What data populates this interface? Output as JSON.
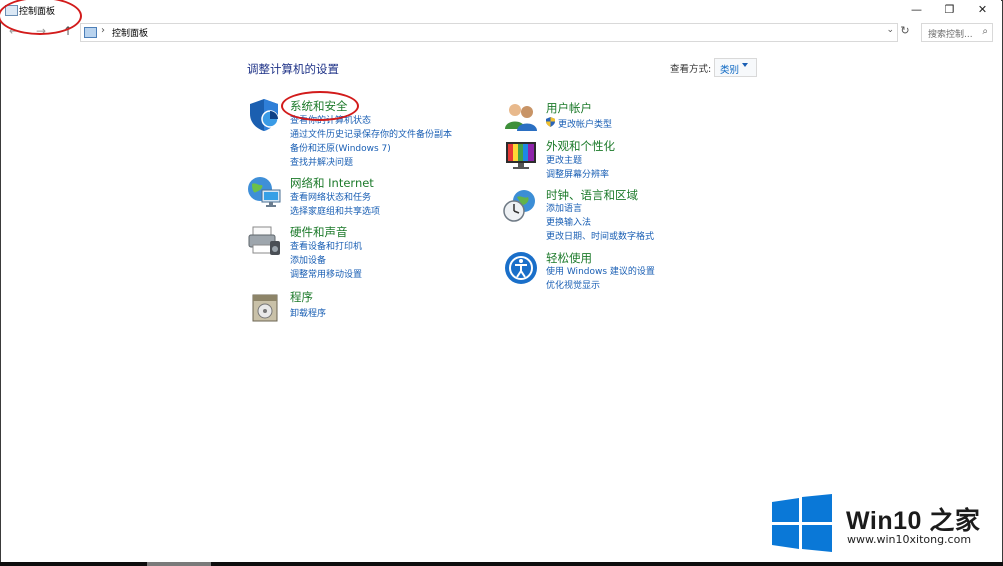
{
  "window": {
    "title": "控制面板",
    "minimize": "—",
    "restore": "❐",
    "close": "✕"
  },
  "address_bar": {
    "back": "←",
    "forward": "→",
    "up": "↑",
    "separator": "›",
    "path": "控制面板",
    "dropdown": "⌄",
    "refresh": "↻",
    "search_placeholder": "搜索控制...",
    "search_icon": "⌕"
  },
  "header": {
    "title": "调整计算机的设置",
    "view_by_label": "查看方式:",
    "view_by_value": "类别"
  },
  "categories_left": [
    {
      "title": "系统和安全",
      "icon": "shield-icon",
      "links": [
        "查看你的计算机状态",
        "通过文件历史记录保存你的文件备份副本",
        "备份和还原(Windows 7)",
        "查找并解决问题"
      ]
    },
    {
      "title": "网络和 Internet",
      "icon": "network-globe-icon",
      "links": [
        "查看网络状态和任务",
        "选择家庭组和共享选项"
      ]
    },
    {
      "title": "硬件和声音",
      "icon": "printer-icon",
      "links": [
        "查看设备和打印机",
        "添加设备",
        "调整常用移动设置"
      ]
    },
    {
      "title": "程序",
      "icon": "program-box-icon",
      "links": [
        "卸载程序"
      ]
    }
  ],
  "categories_right": [
    {
      "title": "用户帐户",
      "icon": "users-icon",
      "links": [
        "更改帐户类型"
      ]
    },
    {
      "title": "外观和个性化",
      "icon": "monitor-colors-icon",
      "links": [
        "更改主题",
        "调整屏幕分辨率"
      ]
    },
    {
      "title": "时钟、语言和区域",
      "icon": "clock-globe-icon",
      "links": [
        "添加语言",
        "更换输入法",
        "更改日期、时间或数字格式"
      ]
    },
    {
      "title": "轻松使用",
      "icon": "accessibility-icon",
      "links": [
        "使用 Windows 建议的设置",
        "优化视觉显示"
      ]
    }
  ],
  "watermark": {
    "brand": "Win10 之家",
    "url": "www.win10xitong.com"
  },
  "colors": {
    "accent_link": "#1a5fb4",
    "category_title": "#1c7a2a",
    "page_title": "#1e3287",
    "annotation": "#d21b1b",
    "windows_logo": "#0a78d7"
  }
}
